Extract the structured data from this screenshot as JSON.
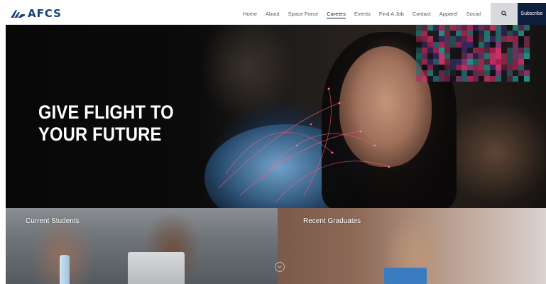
{
  "brand": {
    "logo_text": "AFCS"
  },
  "nav": {
    "items": [
      {
        "label": "Home"
      },
      {
        "label": "About"
      },
      {
        "label": "Space Force"
      },
      {
        "label": "Careers"
      },
      {
        "label": "Events"
      },
      {
        "label": "Find A Job"
      },
      {
        "label": "Contact"
      },
      {
        "label": "Apparel"
      },
      {
        "label": "Social"
      }
    ],
    "active": "Careers",
    "search_icon": "search-icon",
    "subscribe_label": "Subscribe"
  },
  "hero": {
    "title_line1": "GIVE FLIGHT TO",
    "title_line2": "YOUR FUTURE"
  },
  "cards": [
    {
      "title": "Current Students"
    },
    {
      "title": "Recent Graduates"
    }
  ],
  "colors": {
    "brand_blue": "#18407a",
    "subscribe_bg": "#0e1f3e",
    "search_bg": "#d8d9dc"
  }
}
